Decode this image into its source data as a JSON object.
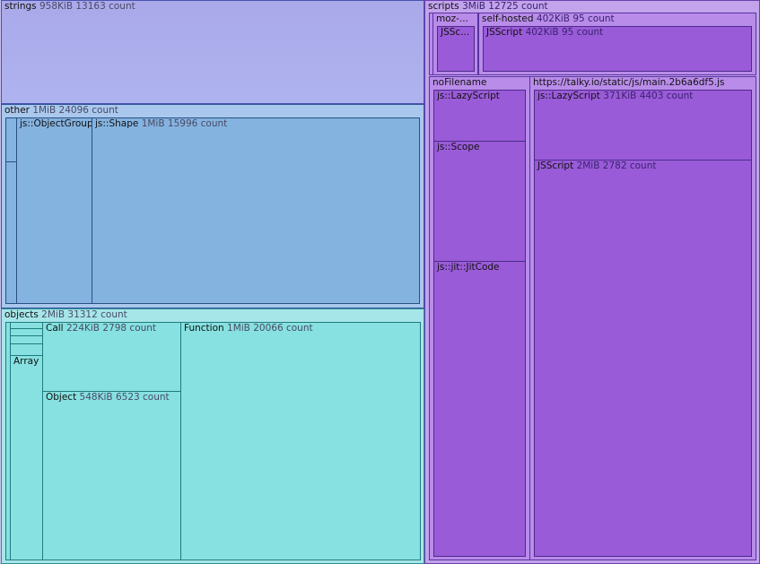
{
  "strings": {
    "name": "strings",
    "size": "958KiB",
    "count": "13163 count"
  },
  "other": {
    "name": "other",
    "size": "1MiB",
    "count": "24096 count",
    "object_group": {
      "name": "js::ObjectGroup"
    },
    "shape": {
      "name": "js::Shape",
      "size": "1MiB",
      "count": "15996 count"
    }
  },
  "objects": {
    "name": "objects",
    "size": "2MiB",
    "count": "31312 count",
    "array": {
      "name": "Array"
    },
    "call": {
      "name": "Call",
      "size": "224KiB",
      "count": "2798 count"
    },
    "object": {
      "name": "Object",
      "size": "548KiB",
      "count": "6523 count"
    },
    "function": {
      "name": "Function",
      "size": "1MiB",
      "count": "20066 count"
    }
  },
  "scripts": {
    "name": "scripts",
    "size": "3MiB",
    "count": "12725 count",
    "moz": {
      "name": "moz-...",
      "child": "JSSc..."
    },
    "self_hosted": {
      "name": "self-hosted",
      "size": "402KiB",
      "count": "95 count",
      "jsscript": {
        "name": "JSScript",
        "size": "402KiB",
        "count": "95 count"
      }
    },
    "no_filename": {
      "name": "noFilename",
      "lazy_script": {
        "name": "js::LazyScript"
      },
      "scope": {
        "name": "js::Scope"
      },
      "jit_code": {
        "name": "js::jit::JitCode"
      }
    },
    "talky": {
      "name": "https://talky.io/static/js/main.2b6a6df5.js",
      "lazy_script": {
        "name": "js::LazyScript",
        "size": "371KiB",
        "count": "4403 count"
      },
      "jsscript": {
        "name": "JSScript",
        "size": "2MiB",
        "count": "2782 count"
      }
    }
  }
}
